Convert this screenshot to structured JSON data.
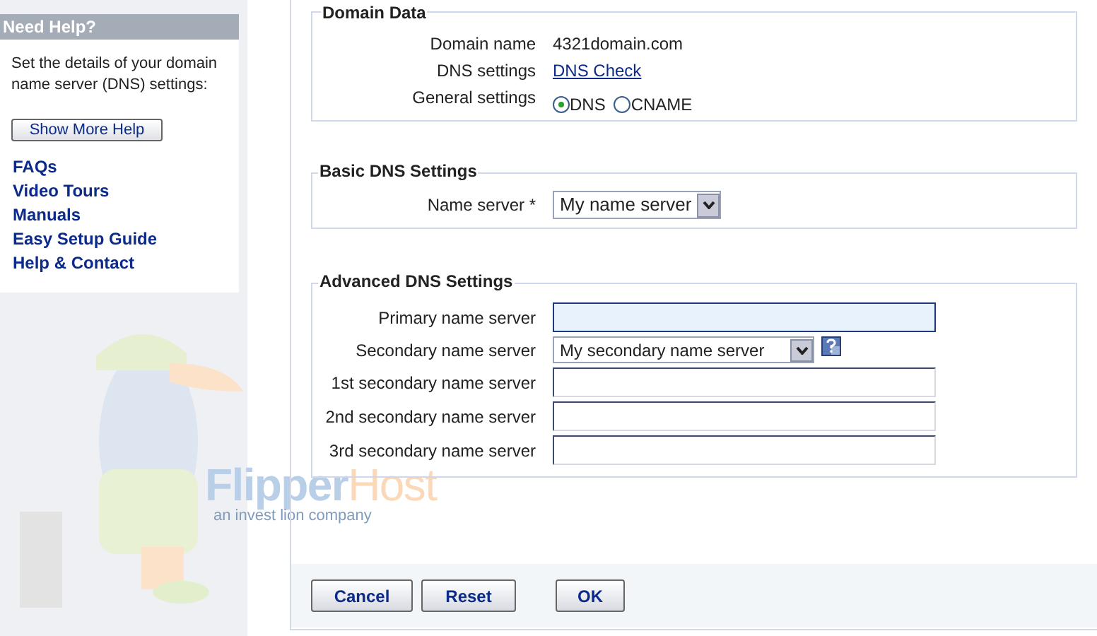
{
  "help_panel": {
    "title": "Need Help?",
    "text": "Set the details of your domain name server (DNS) settings:",
    "button": "Show More Help",
    "links": [
      "FAQs",
      "Video Tours",
      "Manuals",
      "Easy Setup Guide",
      "Help & Contact"
    ]
  },
  "logo": {
    "name_part_1": "Flipper",
    "name_part_2": "Host",
    "tagline": "an invest lion company"
  },
  "domain_data": {
    "legend": "Domain Data",
    "domain_name_label": "Domain name",
    "domain_name": "4321domain.com",
    "dns_settings_label": "DNS settings",
    "dns_settings_link": "DNS Check",
    "general_settings_label": "General settings",
    "options": [
      {
        "label": "DNS",
        "selected": true
      },
      {
        "label": "CNAME",
        "selected": false
      }
    ]
  },
  "basic_dns": {
    "legend": "Basic DNS Settings",
    "name_server_label": "Name server *",
    "name_server_value": "My name server"
  },
  "advanced_dns": {
    "legend": "Advanced DNS Settings",
    "rows": [
      {
        "kind": "input",
        "label": "Primary name server",
        "value": "",
        "focused": true
      },
      {
        "kind": "select",
        "label": "Secondary name server",
        "value": "My secondary name server"
      },
      {
        "kind": "input",
        "label": "1st secondary name server",
        "value": "",
        "focused": false
      },
      {
        "kind": "input",
        "label": "2nd secondary name server",
        "value": "",
        "focused": false
      },
      {
        "kind": "input",
        "label": "3rd secondary name server",
        "value": "",
        "focused": false
      }
    ]
  },
  "buttons": [
    "Cancel",
    "Reset",
    "OK"
  ]
}
